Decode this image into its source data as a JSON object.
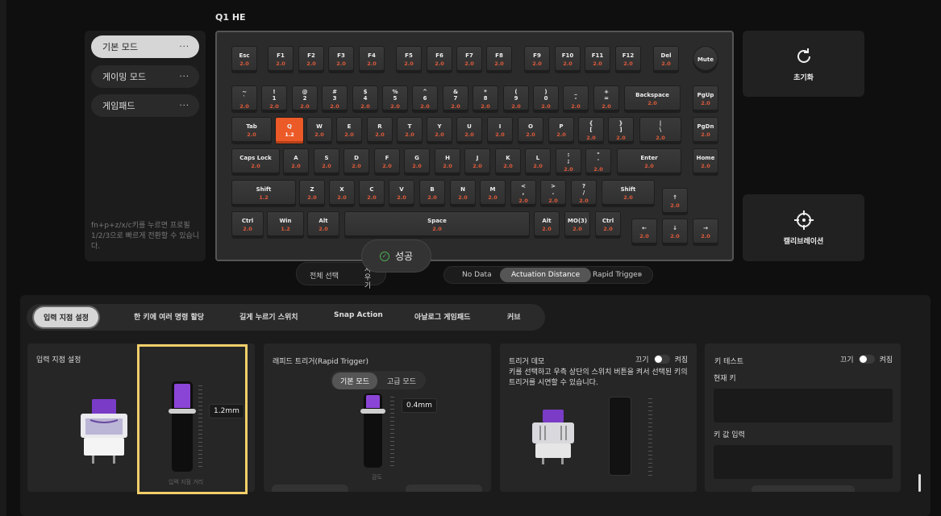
{
  "device": {
    "title": "Q1 HE"
  },
  "modes": {
    "items": [
      {
        "label": "기본 모드",
        "dots": "···"
      },
      {
        "label": "게이밍 모드",
        "dots": "···"
      },
      {
        "label": "게임패드",
        "dots": "···"
      }
    ],
    "hint": "fn+p+z/x/c키를 누르면 프로필 1/2/3으로 빠르게 전환할 수 있습니다."
  },
  "keyboard": {
    "keys": [
      {
        "l": "Esc",
        "v": "2.0"
      },
      {
        "l": "F1",
        "v": "2.0"
      },
      {
        "l": "F2",
        "v": "2.0"
      },
      {
        "l": "F3",
        "v": "2.0"
      },
      {
        "l": "F4",
        "v": "2.0"
      },
      {
        "l": "F5",
        "v": "2.0"
      },
      {
        "l": "F6",
        "v": "2.0"
      },
      {
        "l": "F7",
        "v": "2.0"
      },
      {
        "l": "F8",
        "v": "2.0"
      },
      {
        "l": "F9",
        "v": "2.0"
      },
      {
        "l": "F10",
        "v": "2.0"
      },
      {
        "l": "F11",
        "v": "2.0"
      },
      {
        "l": "F12",
        "v": "2.0"
      },
      {
        "l": "Del",
        "v": "2.0"
      },
      {
        "l": "Mute",
        "v": ""
      },
      {
        "l": "~\n`",
        "v": "2.0"
      },
      {
        "l": "!\n1",
        "v": "2.0"
      },
      {
        "l": "@\n2",
        "v": "2.0"
      },
      {
        "l": "#\n3",
        "v": "2.0"
      },
      {
        "l": "$\n4",
        "v": "2.0"
      },
      {
        "l": "%\n5",
        "v": "2.0"
      },
      {
        "l": "^\n6",
        "v": "2.0"
      },
      {
        "l": "&\n7",
        "v": "2.0"
      },
      {
        "l": "*\n8",
        "v": "2.0"
      },
      {
        "l": "(\n9",
        "v": "2.0"
      },
      {
        "l": ")\n0",
        "v": "2.0"
      },
      {
        "l": "_\n-",
        "v": "2.0"
      },
      {
        "l": "+\n=",
        "v": "2.0"
      },
      {
        "l": "Backspace",
        "v": "2.0"
      },
      {
        "l": "PgUp",
        "v": "2.0"
      },
      {
        "l": "Tab",
        "v": "2.0"
      },
      {
        "l": "Q",
        "v": "1.2"
      },
      {
        "l": "W",
        "v": "2.0"
      },
      {
        "l": "E",
        "v": "2.0"
      },
      {
        "l": "R",
        "v": "2.0"
      },
      {
        "l": "T",
        "v": "2.0"
      },
      {
        "l": "Y",
        "v": "2.0"
      },
      {
        "l": "U",
        "v": "2.0"
      },
      {
        "l": "I",
        "v": "2.0"
      },
      {
        "l": "O",
        "v": "2.0"
      },
      {
        "l": "P",
        "v": "2.0"
      },
      {
        "l": "{\n[",
        "v": "2.0"
      },
      {
        "l": "}\n]",
        "v": "2.0"
      },
      {
        "l": "|\n\\",
        "v": "2.0"
      },
      {
        "l": "PgDn",
        "v": "2.0"
      },
      {
        "l": "Caps Lock",
        "v": "2.0"
      },
      {
        "l": "A",
        "v": "2.0"
      },
      {
        "l": "S",
        "v": "2.0"
      },
      {
        "l": "D",
        "v": "2.0"
      },
      {
        "l": "F",
        "v": "2.0"
      },
      {
        "l": "G",
        "v": "2.0"
      },
      {
        "l": "H",
        "v": "2.0"
      },
      {
        "l": "J",
        "v": "2.0"
      },
      {
        "l": "K",
        "v": "2.0"
      },
      {
        "l": "L",
        "v": "2.0"
      },
      {
        "l": ":\n;",
        "v": "2.0"
      },
      {
        "l": "\"\n'",
        "v": "2.0"
      },
      {
        "l": "Enter",
        "v": "2.0"
      },
      {
        "l": "Home",
        "v": "2.0"
      },
      {
        "l": "Shift",
        "v": "1.2"
      },
      {
        "l": "Z",
        "v": "2.0"
      },
      {
        "l": "X",
        "v": "2.0"
      },
      {
        "l": "C",
        "v": "2.0"
      },
      {
        "l": "V",
        "v": "2.0"
      },
      {
        "l": "B",
        "v": "2.0"
      },
      {
        "l": "N",
        "v": "2.0"
      },
      {
        "l": "M",
        "v": "2.0"
      },
      {
        "l": "<\n,",
        "v": "2.0"
      },
      {
        "l": ">\n.",
        "v": "2.0"
      },
      {
        "l": "?\n/",
        "v": "2.0"
      },
      {
        "l": "Shift",
        "v": "2.0"
      },
      {
        "l": "↑",
        "v": "2.0"
      },
      {
        "l": "Ctrl",
        "v": "2.0"
      },
      {
        "l": "Win",
        "v": "1.2"
      },
      {
        "l": "Alt",
        "v": "2.0"
      },
      {
        "l": "Space",
        "v": "2.0"
      },
      {
        "l": "Alt",
        "v": "2.0"
      },
      {
        "l": "MO(3)",
        "v": "2.0"
      },
      {
        "l": "Ctrl",
        "v": "2.0"
      },
      {
        "l": "←",
        "v": "2.0"
      },
      {
        "l": "↓",
        "v": "2.0"
      },
      {
        "l": "→",
        "v": "2.0"
      }
    ],
    "selected_key": "Q"
  },
  "side": {
    "reset": "초기화",
    "calibrate": "캘리브레이션"
  },
  "toolbar": {
    "select_all": "전체 선택",
    "erase": "지우기"
  },
  "toast": {
    "text": "성공"
  },
  "display_seg": {
    "no_data": "No Data",
    "actuation": "Actuation Distance",
    "rapid": "Rapid Trigger"
  },
  "tabs": [
    "입력 지점 설정",
    "한 키에 여러 명령 할당",
    "길게 누르기 스위치",
    "Snap Action",
    "아날로그 게임패드",
    "커브"
  ],
  "actuation": {
    "title": "입력 지점 설정",
    "value": "1.2mm",
    "level": 0.31,
    "caption": "입력 지점 거리"
  },
  "rapid": {
    "title": "래피드 트리거(Rapid Trigger)",
    "mode_basic": "기본 모드",
    "mode_adv": "고급 모드",
    "value": "0.4mm",
    "level": 0.1,
    "caption": "감도"
  },
  "demo": {
    "title": "트리거 데모",
    "off": "끄기",
    "on": "켜짐",
    "desc": "키를 선택하고 우측 상단의 스위치 버튼을 켜서 선택된 키의 트리거를 시연할 수 있습니다."
  },
  "keytest": {
    "title": "키 테스트",
    "off": "끄기",
    "on": "켜짐",
    "current": "현재 키",
    "value": "키 값 입력"
  },
  "colors": {
    "accent": "#ec5a27",
    "purple": "#8b45d6",
    "highlight": "#f2cf6a"
  }
}
